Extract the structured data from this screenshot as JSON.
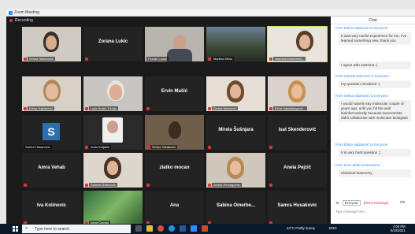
{
  "window": {
    "title": "Zoom Meeting"
  },
  "recording": {
    "label": "Recording"
  },
  "gallery": {
    "tiles": [
      {
        "name": "",
        "caption": "Selma Salamović",
        "video": true,
        "mic_muted": true
      },
      {
        "name": "Zorana Lukic",
        "caption": "",
        "video": false,
        "mic_muted": true
      },
      {
        "name": "",
        "caption": "Florian Loose",
        "video": true,
        "mic_muted": false
      },
      {
        "name": "",
        "caption": "Martina Meso",
        "video": true,
        "mic_muted": true
      },
      {
        "name": "",
        "caption": "Jasmina Kamberov...",
        "video": true,
        "mic_muted": true
      },
      {
        "name": "",
        "caption": "Edina Hajdarević",
        "video": true,
        "mic_muted": true
      },
      {
        "name": "",
        "caption": "Lejla Bratić-Trkulja",
        "video": true,
        "mic_muted": true
      },
      {
        "name": "Ervin Mašić",
        "caption": "",
        "video": false,
        "mic_muted": true
      },
      {
        "name": "",
        "caption": "Emina Islamović",
        "video": true,
        "mic_muted": true
      },
      {
        "name": "",
        "caption": "Elma Hajdarbegović...",
        "video": true,
        "mic_muted": true
      },
      {
        "name": "",
        "caption": "Samra Hasanović",
        "video": true,
        "mic_muted": true
      },
      {
        "name": "",
        "caption": "Avdo Kuljanin",
        "video": true,
        "mic_muted": true
      },
      {
        "name": "",
        "caption": "Selma Tabaković",
        "video": true,
        "mic_muted": true
      },
      {
        "name": "Mirela Šušnjara",
        "caption": "",
        "video": false,
        "mic_muted": true
      },
      {
        "name": "Isat Skenderović",
        "caption": "",
        "video": false,
        "mic_muted": true
      },
      {
        "name": "Amra Vehab",
        "caption": "",
        "video": false,
        "mic_muted": true
      },
      {
        "name": "",
        "caption": "Samela Selimović",
        "video": true,
        "mic_muted": true
      },
      {
        "name": "zlatko mocan",
        "caption": "",
        "video": false,
        "mic_muted": true
      },
      {
        "name": "",
        "caption": "Amela Hercegovac",
        "video": true,
        "mic_muted": true
      },
      {
        "name": "Anela Pejzić",
        "caption": "",
        "video": false,
        "mic_muted": true
      },
      {
        "name": "Iva Kolinovic",
        "caption": "",
        "video": false,
        "mic_muted": true
      },
      {
        "name": "",
        "caption": "Alma Čavalić",
        "video": true,
        "mic_muted": true
      },
      {
        "name": "Ana",
        "caption": "",
        "video": false,
        "mic_muted": true
      },
      {
        "name": "Sabina Omerbe...",
        "caption": "",
        "video": false,
        "mic_muted": true
      },
      {
        "name": "Samra Husakovic",
        "caption": "",
        "video": false,
        "mic_muted": true
      }
    ]
  },
  "chat": {
    "title": "Chat",
    "messages": [
      {
        "from": "From Edina Hajdarević to Everyone:",
        "text": "It was very useful experience for me. I've learned something new, thank you"
      },
      {
        "from": "",
        "text": "I agree with Jasmina :)"
      },
      {
        "from": "From Samela Selimović to Everyone:",
        "text": "my question remained :("
      },
      {
        "from": "From Selma Salamović to Everyone:",
        "text": "I would naively say molecular couple of years ago, until you hit the wall bioinformatically because taxonomists didnt collaborate with molecular biologists"
      },
      {
        "from": "From Edina Hajdarević to Everyone:",
        "text": "It is very hard question :)"
      },
      {
        "from": "From Ervin Mašić to Everyone:",
        "text": "Classical taxonomy"
      }
    ],
    "to_label": "To:",
    "to_value": "Everyone",
    "direct_message": "(Direct Message)",
    "file_label": "File",
    "input_placeholder": "Type message here..."
  },
  "taskbar": {
    "search_placeholder": "Type here to search",
    "weather": "24°C Partly sunny",
    "tray": "ENG",
    "time": "4:00 PM",
    "date": "6/10/2021"
  }
}
